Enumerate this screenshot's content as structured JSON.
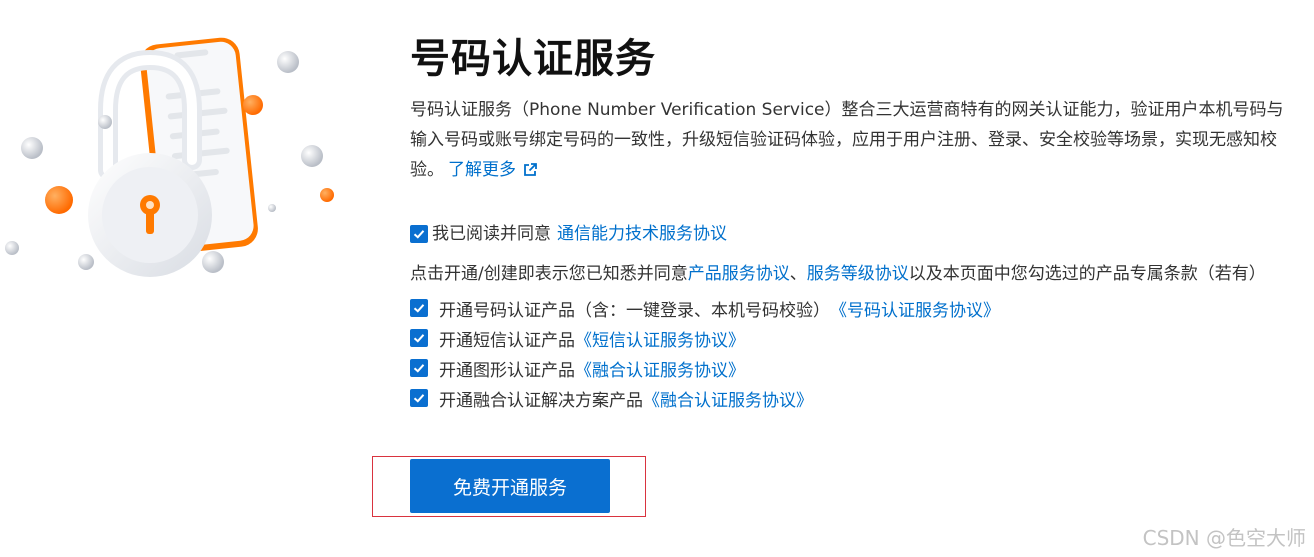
{
  "header": {
    "title": "号码认证服务"
  },
  "description": {
    "text": "号码认证服务（Phone Number Verification Service）整合三大运营商特有的网关认证能力，验证用户本机号码与输入号码或账号绑定号码的一致性，升级短信验证码体验，应用于用户注册、登录、安全校验等场景，实现无感知校验。",
    "learn_more": "了解更多"
  },
  "agreement": {
    "checked": true,
    "prefix": "我已阅读并同意",
    "link": "通信能力技术服务协议"
  },
  "notice": {
    "prefix": "点击开通/创建即表示您已知悉并同意",
    "link1": "产品服务协议",
    "sep": "、",
    "link2": "服务等级协议",
    "suffix": "以及本页面中您勾选过的产品专属条款（若有）"
  },
  "options": [
    {
      "label": "开通号码认证产品（含：一键登录、本机号码校验）",
      "link": "《号码认证服务协议》",
      "checked": true
    },
    {
      "label": "开通短信认证产品",
      "link": "《短信认证服务协议》",
      "checked": true
    },
    {
      "label": "开通图形认证产品",
      "link": "《融合认证服务协议》",
      "checked": true
    },
    {
      "label": "开通融合认证解决方案产品",
      "link": "《融合认证服务协议》",
      "checked": true
    }
  ],
  "primary_button": {
    "label": "免费开通服务"
  },
  "watermark": "CSDN @色空大师",
  "colors": {
    "accent": "#0a6fd0",
    "link": "#0070cc",
    "highlight_border": "#d9333f",
    "orange": "#ff7a00"
  },
  "icons": {
    "external_link": "external-link-icon",
    "check": "check-icon",
    "illustration": "padlock-phone-illustration"
  }
}
